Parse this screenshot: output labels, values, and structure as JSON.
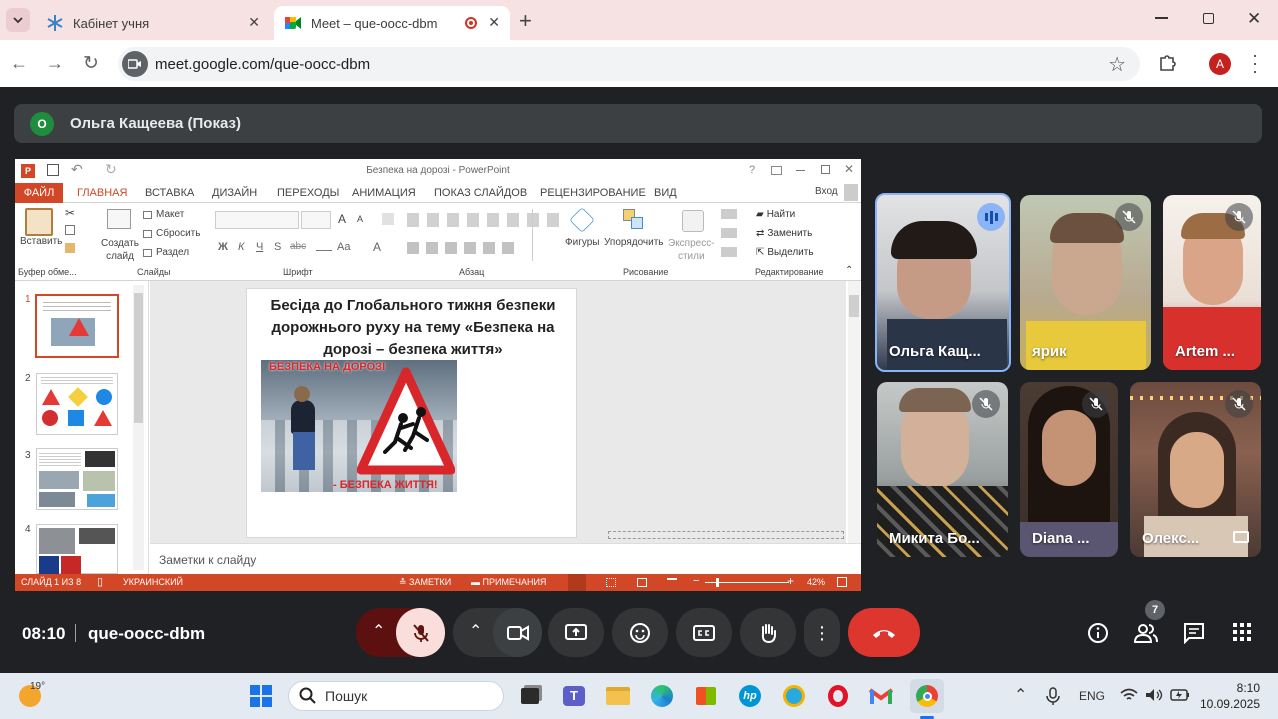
{
  "browser": {
    "tabs": [
      {
        "title": "Кабінет учня"
      },
      {
        "title": "Meet – que-oocc-dbm"
      }
    ],
    "url": "meet.google.com/que-oocc-dbm",
    "profile_initial": "A"
  },
  "presenter": {
    "initial": "О",
    "label": "Ольга Кащеева (Показ)"
  },
  "ppt": {
    "title": "Безпека на дорозі - PowerPoint",
    "help": "?",
    "signin": "Вход",
    "ribbon_tabs": [
      "ФАЙЛ",
      "ГЛАВНАЯ",
      "ВСТАВКА",
      "ДИЗАЙН",
      "ПЕРЕХОДЫ",
      "АНИМАЦИЯ",
      "ПОКАЗ СЛАЙДОВ",
      "РЕЦЕНЗИРОВАНИЕ",
      "ВИД"
    ],
    "groups": [
      "Буфер обме...",
      "Слайды",
      "Шрифт",
      "Абзац",
      "Рисование",
      "Редактирование"
    ],
    "cmd": {
      "paste": "Вставить",
      "create_slide_1": "Создать",
      "create_slide_2": "слайд",
      "layout": "Макет",
      "reset": "Сбросить",
      "section": "Раздел",
      "shapes": "Фигуры",
      "arrange": "Упорядочить",
      "express_1": "Экспресс-",
      "express_2": "стили",
      "find": "Найти",
      "replace": "Заменить",
      "select": "Выделить",
      "font_grow": "A",
      "font_shrink": "A",
      "fmt_bold": "Ж",
      "fmt_italic": "К",
      "fmt_underline": "Ч",
      "fmt_shadow": "S",
      "fmt_strike": "abc",
      "font_case": "Aa",
      "font_color": "A"
    },
    "thumb_numbers": [
      "1",
      "2",
      "3",
      "4"
    ],
    "slide": {
      "title": "Бесіда до Глобального тижня безпеки дорожнього руху на тему «Безпека на дорозі – безпека життя»",
      "banner_top": "БЕЗПЕКА НА ДОРОЗІ",
      "banner_bottom": "- БЕЗПЕКА ЖИТТЯ!"
    },
    "notes_placeholder": "Заметки к слайду",
    "status": {
      "slide": "СЛАЙД 1 ИЗ 8",
      "lang": "УКРАИНСКИЙ",
      "notes": "ЗАМЕТКИ",
      "comments": "ПРИМЕЧАНИЯ",
      "zoom": "42%"
    },
    "colors": {
      "accent": "#d24726"
    }
  },
  "participants": [
    {
      "name": "Ольга Кащ...",
      "speaking": true
    },
    {
      "name": "ярик",
      "speaking": false
    },
    {
      "name": "Artem ...",
      "speaking": false
    },
    {
      "name": "Микита Бо...",
      "speaking": false
    },
    {
      "name": "Diana ...",
      "speaking": false
    },
    {
      "name": "Олекс...",
      "speaking": false
    }
  ],
  "meet_bar": {
    "time": "08:10",
    "code": "que-oocc-dbm",
    "people_count": "7"
  },
  "taskbar": {
    "weather": "19°",
    "search": "Пошук",
    "lang": "ENG",
    "clock_time": "8:10",
    "clock_date": "10.09.2025"
  }
}
